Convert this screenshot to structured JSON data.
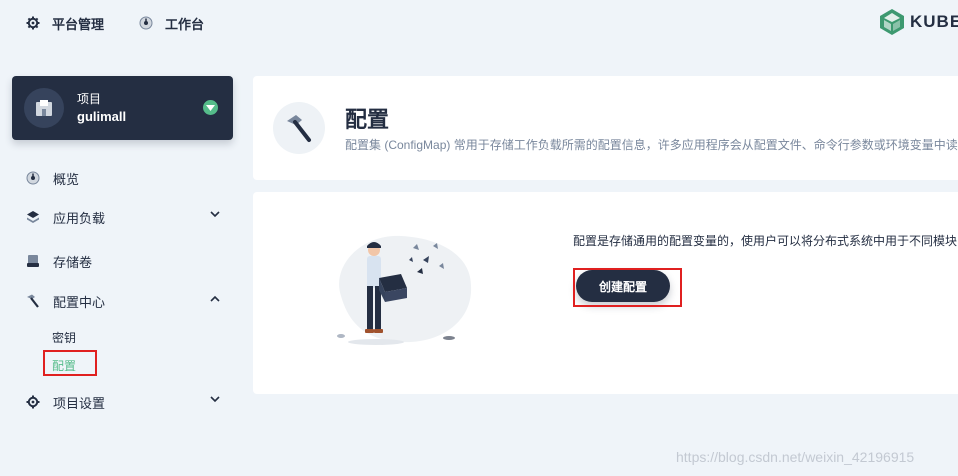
{
  "topbar": {
    "platform_label": "平台管理",
    "workbench_label": "工作台",
    "logo_text": "KUBES"
  },
  "project": {
    "type_label": "项目",
    "name": "gulimall"
  },
  "sidebar": {
    "items": [
      {
        "label": "概览",
        "icon": "dashboard-icon"
      },
      {
        "label": "应用负载",
        "icon": "layers-icon"
      },
      {
        "label": "存储卷",
        "icon": "storage-icon"
      },
      {
        "label": "配置中心",
        "icon": "hammer-icon"
      },
      {
        "label": "项目设置",
        "icon": "gear-icon"
      }
    ],
    "config_subitems": [
      {
        "label": "密钥"
      },
      {
        "label": "配置"
      }
    ]
  },
  "header": {
    "title": "配置",
    "description": "配置集 (ConfigMap) 常用于存储工作负载所需的配置信息，许多应用程序会从配置文件、命令行参数或环境变量中读"
  },
  "empty_state": {
    "text": "配置是存储通用的配置变量的，使用户可以将分布式系统中用于不同模块",
    "button_label": "创建配置"
  },
  "watermark": "https://blog.csdn.net/weixin_42196915",
  "colors": {
    "accent": "#55bc8a",
    "dark": "#242e42",
    "highlight": "#e02020"
  }
}
